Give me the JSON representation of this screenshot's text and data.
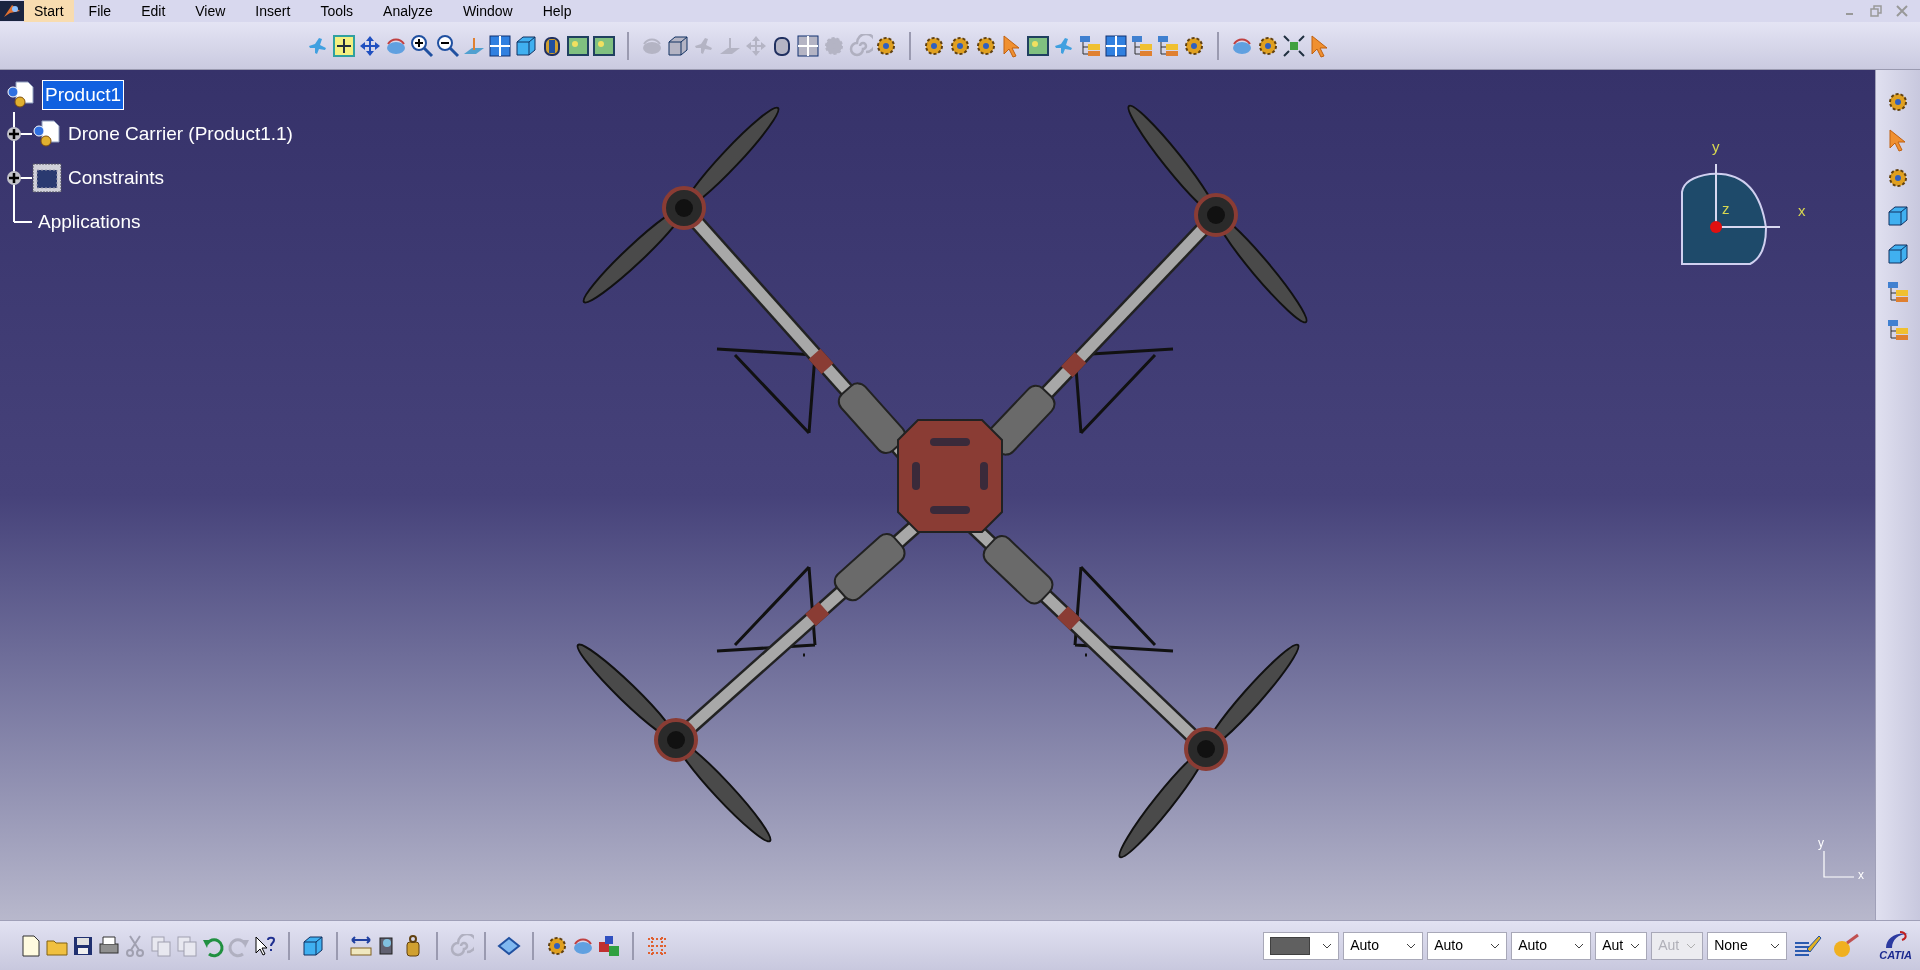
{
  "menu": [
    {
      "label": "Start",
      "selected": true
    },
    {
      "label": "File",
      "selected": false
    },
    {
      "label": "Edit",
      "selected": false
    },
    {
      "label": "View",
      "selected": false
    },
    {
      "label": "Insert",
      "selected": false
    },
    {
      "label": "Tools",
      "selected": false
    },
    {
      "label": "Analyze",
      "selected": false
    },
    {
      "label": "Window",
      "selected": false
    },
    {
      "label": "Help",
      "selected": false
    }
  ],
  "tree": {
    "label": "Product1",
    "selected": true,
    "children": [
      {
        "label": "Drone Carrier (Product1.1)",
        "kind": "product",
        "expandable": true,
        "selected": false
      },
      {
        "label": "Constraints",
        "kind": "constraints",
        "expandable": true,
        "selected": false
      },
      {
        "label": "Applications",
        "kind": "plain",
        "expandable": false,
        "selected": false
      }
    ]
  },
  "compass": {
    "y": "y",
    "z": "z",
    "x": "x"
  },
  "axis_corner": {
    "y": "y",
    "x": "x"
  },
  "properties": [
    {
      "kind": "color",
      "disabled": false
    },
    {
      "kind": "combo",
      "value": "Auto",
      "disabled": false
    },
    {
      "kind": "combo",
      "value": "Auto",
      "disabled": false
    },
    {
      "kind": "combo",
      "value": "Auto",
      "disabled": false
    },
    {
      "kind": "combo",
      "value": "Aut",
      "disabled": false
    },
    {
      "kind": "combo",
      "value": "Aut",
      "disabled": true
    },
    {
      "kind": "combo",
      "value": "None",
      "disabled": false
    }
  ],
  "logo_text": "CATIA"
}
